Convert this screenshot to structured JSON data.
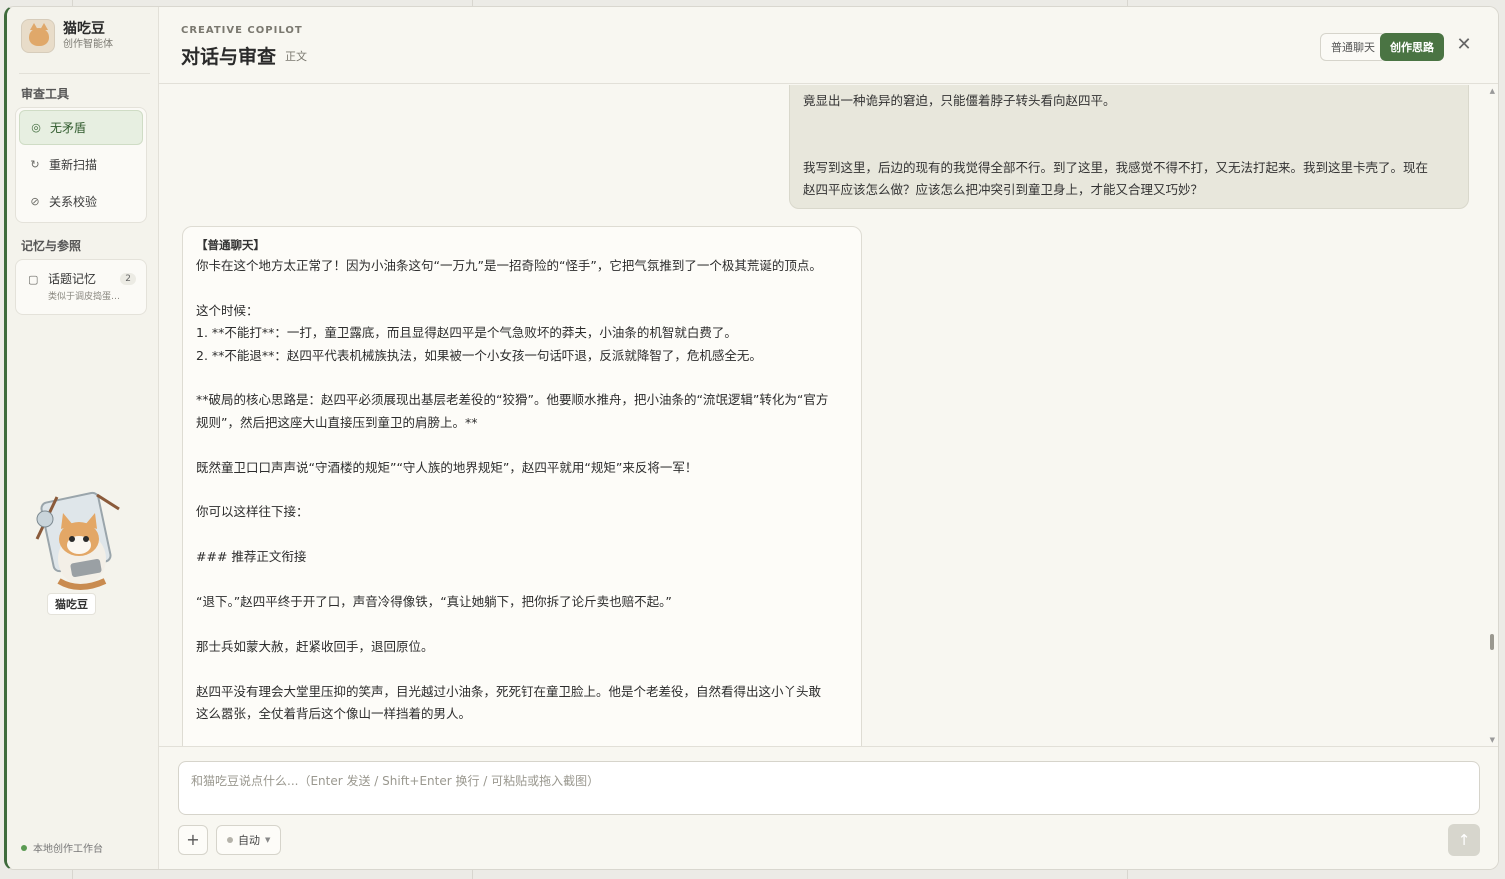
{
  "sidebar": {
    "brand_name": "猫吃豆",
    "brand_sub": "创作智能体",
    "review_title": "审查工具",
    "tools": [
      {
        "label": "无矛盾",
        "icon": "check-circle-icon"
      },
      {
        "label": "重新扫描",
        "icon": "refresh-icon"
      },
      {
        "label": "关系校验",
        "icon": "link-icon"
      }
    ],
    "memory_title": "记忆与参照",
    "memory": {
      "label": "话题记忆",
      "count": "2",
      "sub": "类似于调皮捣蛋…"
    },
    "mascot_label": "猫吃豆",
    "status": "本地创作工作台"
  },
  "header": {
    "eyebrow": "CREATIVE COPILOT",
    "title": "对话与审查",
    "tag": "正文",
    "btn_chat": "普通聊天",
    "btn_idea": "创作思路",
    "close": "✕"
  },
  "chat": {
    "user_lines": [
      "竟显出一种诡异的窘迫，只能僵着脖子转头看向赵四平。",
      "我写到这里，后边的现有的我觉得全部不行。到了这里，我感觉不得不打，又无法打起来。我到这里卡壳了。现在",
      "赵四平应该怎么做？应该怎么把冲突引到童卫身上，才能又合理又巧妙？"
    ],
    "bot_tag": "【普通聊天】",
    "bot_lines": [
      "你卡在这个地方太正常了！因为小油条这句“一万九”是一招奇险的“怪手”，它把气氛推到了一个极其荒诞的顶点。",
      "",
      "这个时候：",
      "1. **不能打**：一打，童卫露底，而且显得赵四平是个气急败坏的莽夫，小油条的机智就白费了。",
      "2. **不能退**：赵四平代表机械族执法，如果被一个小女孩一句话吓退，反派就降智了，危机感全无。",
      "",
      "**破局的核心思路是：赵四平必须展现出基层老差役的“狡猾”。他要顺水推舟，把小油条的“流氓逻辑”转化为“官方",
      "规则”，然后把这座大山直接压到童卫的肩膀上。**",
      "",
      "既然童卫口口声声说“守酒楼的规矩”“守人族的地界规矩”，赵四平就用“规矩”来反将一军！",
      "",
      "你可以这样往下接：",
      "",
      "### 推荐正文衔接",
      "",
      "“退下。”赵四平终于开了口，声音冷得像铁，“真让她躺下，把你拆了论斤卖也赔不起。”",
      "",
      "那士兵如蒙大赦，赶紧收回手，退回原位。",
      "",
      "赵四平没有理会大堂里压抑的笑声，目光越过小油条，死死钉在童卫脸上。他是个老差役，自然看得出这小丫头敢",
      "这么嚣张，全仗着背后这个像山一样挡着的男人。"
    ]
  },
  "composer": {
    "placeholder": "和猫吃豆说点什么...（Enter 发送 / Shift+Enter 换行 / 可粘贴或拖入截图）",
    "plus": "+",
    "mode": "自动",
    "send": "↑"
  },
  "colors": {
    "accent": "#4a7443",
    "active_bg": "#e7efe1",
    "user_bubble": "#e8e7dc"
  }
}
